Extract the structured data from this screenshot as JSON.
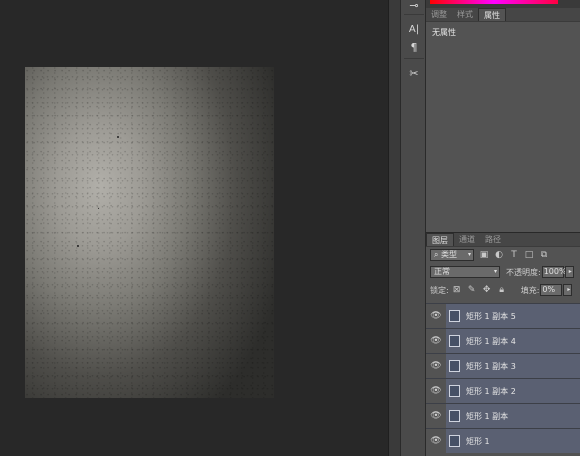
{
  "properties_panel": {
    "tabs": [
      {
        "label": "调整",
        "active": false
      },
      {
        "label": "样式",
        "active": false
      },
      {
        "label": "属性",
        "active": true
      }
    ],
    "message": "无属性"
  },
  "tools": [
    "pin-icon",
    "type-icon",
    "paragraph-icon",
    "tool-presets-icon"
  ],
  "tool_glyphs": {
    "pin": "⊸",
    "type": "A|",
    "paragraph": "¶",
    "presets": "✂"
  },
  "layers_panel": {
    "tabs": [
      {
        "label": "图层",
        "active": true
      },
      {
        "label": "通道",
        "active": false
      },
      {
        "label": "路径",
        "active": false
      }
    ],
    "filter_kind": "类型",
    "blend_mode": "正常",
    "opacity_label": "不透明度:",
    "opacity_value": "100%",
    "lock_label": "锁定:",
    "fill_label": "填充:",
    "fill_value": "0%",
    "layers": [
      {
        "name": "矩形 1 副本 5"
      },
      {
        "name": "矩形 1 副本 4"
      },
      {
        "name": "矩形 1 副本 3"
      },
      {
        "name": "矩形 1 副本 2"
      },
      {
        "name": "矩形 1 副本"
      },
      {
        "name": "矩形 1"
      }
    ]
  },
  "colors": {
    "layer_selected": "#5a6072",
    "panel_bg": "#535353",
    "app_bg": "#282828"
  }
}
